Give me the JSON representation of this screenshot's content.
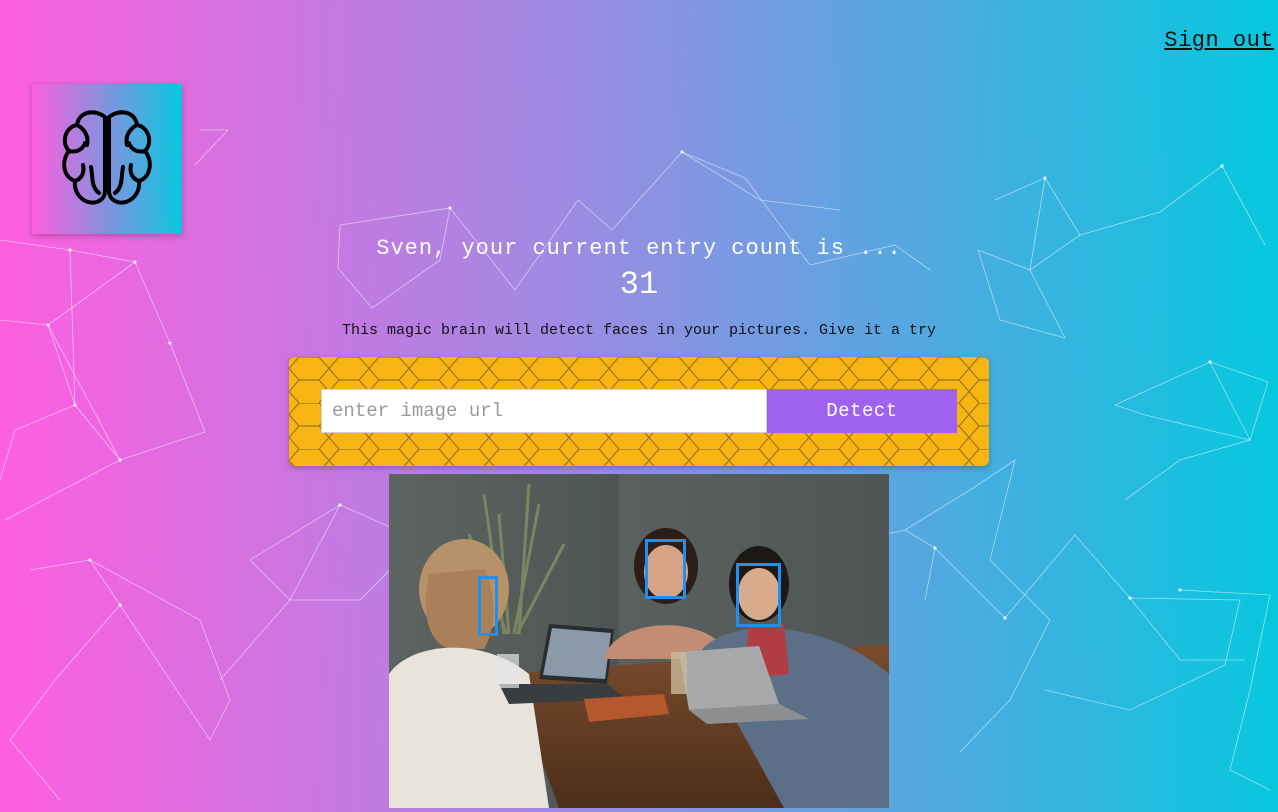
{
  "header": {
    "signout_label": "Sign out"
  },
  "logo": {
    "icon": "brain-icon"
  },
  "rank": {
    "greeting": "Sven, your current entry count is ...",
    "count": "31"
  },
  "tagline": "This magic brain will detect faces in your pictures. Give it a try",
  "form": {
    "input_placeholder": "enter image url",
    "input_value": "",
    "detect_label": "Detect"
  },
  "result": {
    "image_subject": "three people laughing at a cafe table with laptops",
    "face_count": 3
  },
  "colors": {
    "gradient_start": "#ff5edf",
    "gradient_end": "#04c8de",
    "button": "#9f61f0",
    "panel": "#f6b512",
    "face_box": "#1f8ff0"
  }
}
